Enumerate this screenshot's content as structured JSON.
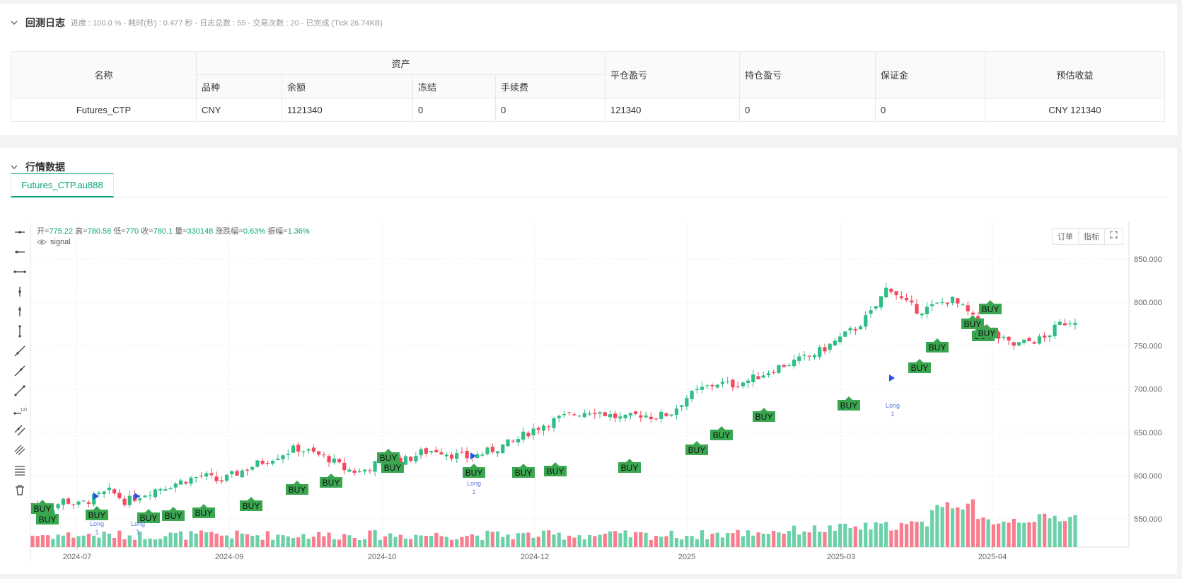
{
  "log": {
    "title": "回测日志",
    "meta": "进度 : 100.0 % - 耗时(秒) : 0.477 秒 - 日志总数 : 55 - 交易次数 : 20 - 已完成 (Tick 26.74KB)",
    "headers": {
      "name": "名称",
      "assets": "资产",
      "variety": "品种",
      "balance": "余额",
      "frozen": "冻结",
      "fee": "手续费",
      "close_pnl": "平仓盈亏",
      "position_pnl": "持仓盈亏",
      "margin": "保证金",
      "est_profit": "预估收益"
    },
    "row": {
      "name": "Futures_CTP",
      "variety": "CNY",
      "balance": "1121340",
      "frozen": "0",
      "fee": "0",
      "close_pnl": "121340",
      "position_pnl": "0",
      "margin": "0",
      "est_profit": "CNY 121340"
    }
  },
  "market": {
    "title": "行情数据",
    "tab": "Futures_CTP.au888",
    "ohlc": {
      "open_label": "开=",
      "open": "775.22",
      "high_label": "高=",
      "high": "780.58",
      "low_label": "低=",
      "low": "770",
      "close_label": "收=",
      "close": "780.1",
      "vol_label": "量=",
      "vol": "330148",
      "chg_label": "涨跌幅=",
      "chg": "0.63%",
      "amp_label": "振幅=",
      "amp": "1.36%"
    },
    "signal_label": "signal",
    "buttons": [
      "订单",
      "指标"
    ]
  },
  "colors": {
    "up": "#2ebd85",
    "down": "#f6465d",
    "buy": "#3aa650",
    "arrow": "#2850e8",
    "accent": "#0aa57f"
  },
  "chart_data": {
    "type": "candlestick",
    "y_ticks": [
      "850.000",
      "800.000",
      "750.000",
      "700.000",
      "650.000",
      "600.000",
      "550.000"
    ],
    "x_ticks": [
      "2024-07",
      "2024-09",
      "2024-10",
      "2024-12",
      "2025",
      "2025-03",
      "2025-04"
    ],
    "ylim": [
      520,
      880
    ],
    "close_path": [
      568,
      560,
      572,
      566,
      575,
      582,
      570,
      578,
      585,
      590,
      596,
      600,
      593,
      602,
      610,
      618,
      625,
      632,
      626,
      620,
      608,
      604,
      613,
      620,
      618,
      627,
      630,
      624,
      621,
      626,
      633,
      640,
      652,
      660,
      667,
      672,
      676,
      670,
      665,
      671,
      668,
      672,
      690,
      700,
      707,
      705,
      710,
      718,
      726,
      732,
      738,
      748,
      760,
      772,
      790,
      820,
      800,
      790,
      796,
      804,
      790,
      770,
      760,
      750,
      755,
      758,
      775,
      780.1
    ],
    "signals": [
      "BUY",
      "Long",
      "1"
    ]
  }
}
